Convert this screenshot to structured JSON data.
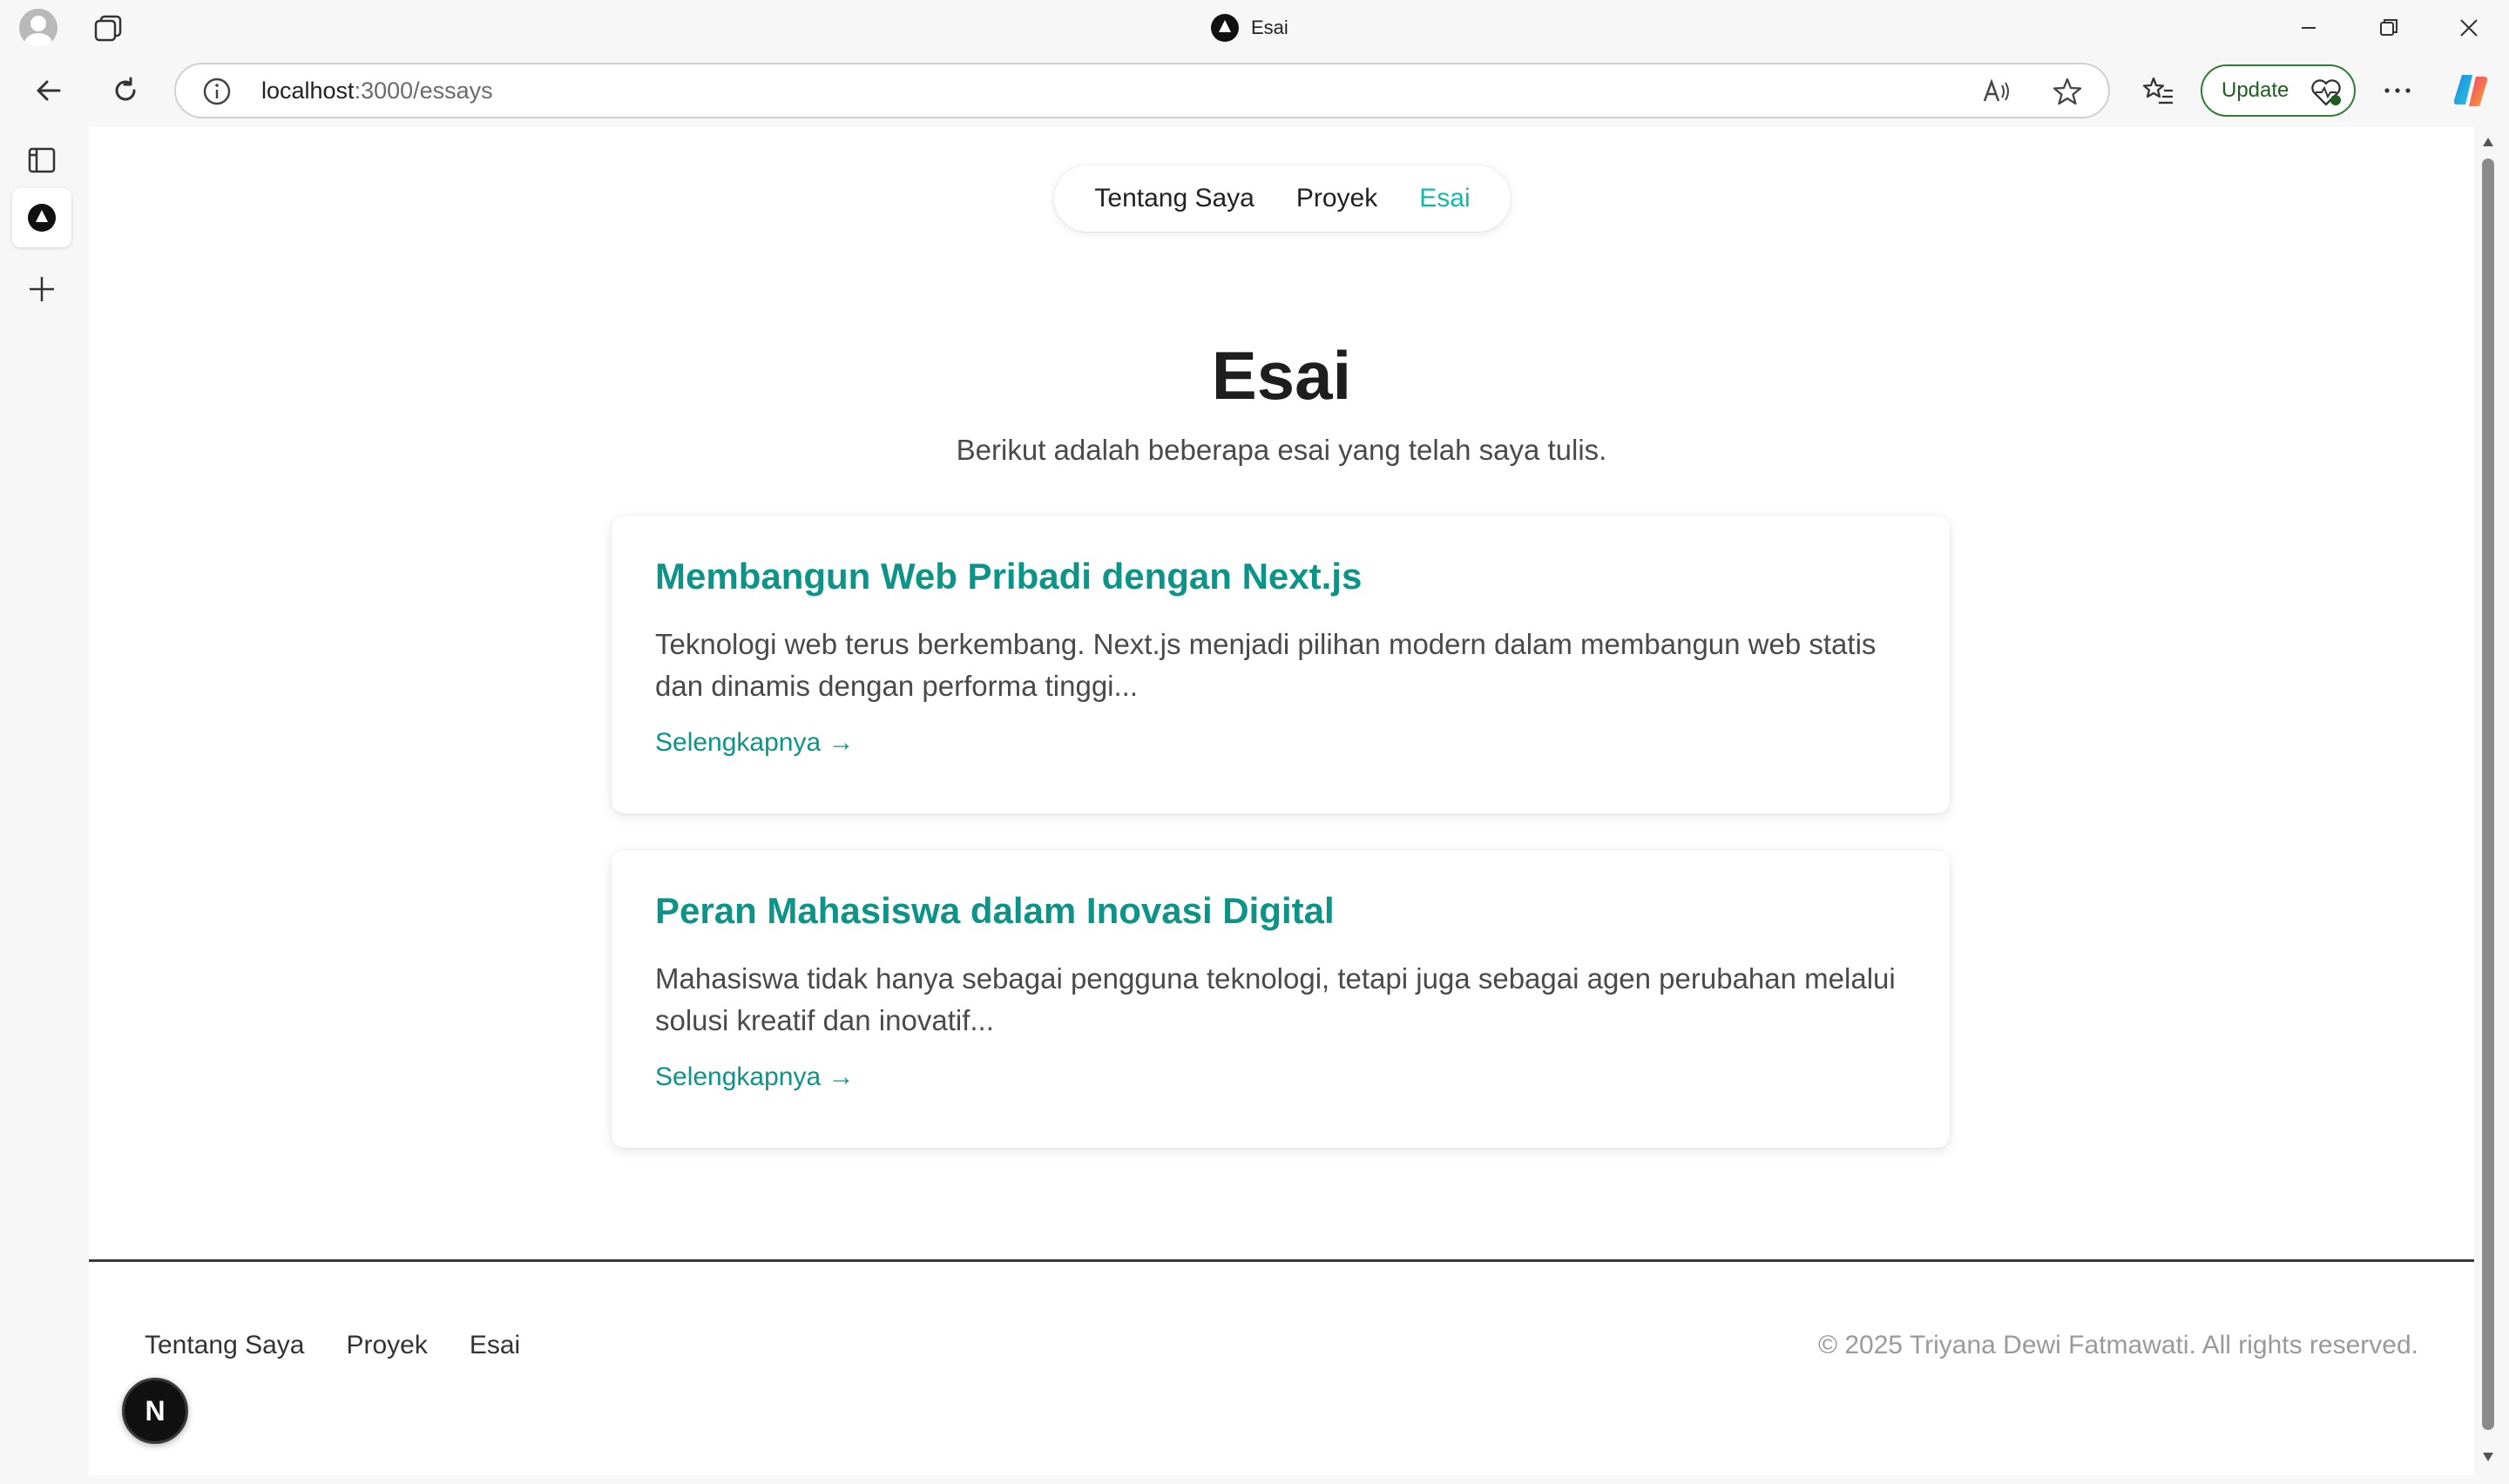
{
  "window": {
    "title": "Esai"
  },
  "toolbar": {
    "url_host": "localhost",
    "url_path": ":3000/essays",
    "update_label": "Update"
  },
  "site_nav": [
    {
      "label": "Tentang Saya",
      "active": false
    },
    {
      "label": "Proyek",
      "active": false
    },
    {
      "label": "Esai",
      "active": true
    }
  ],
  "page": {
    "heading": "Esai",
    "subtitle": "Berikut adalah beberapa esai yang telah saya tulis."
  },
  "essays": [
    {
      "title": "Membangun Web Pribadi dengan Next.js",
      "excerpt": "Teknologi web terus berkembang. Next.js menjadi pilihan modern dalam membangun web statis dan dinamis dengan performa tinggi...",
      "more": "Selengkapnya →"
    },
    {
      "title": "Peran Mahasiswa dalam Inovasi Digital",
      "excerpt": "Mahasiswa tidak hanya sebagai pengguna teknologi, tetapi juga sebagai agen perubahan melalui solusi kreatif dan inovatif...",
      "more": "Selengkapnya →"
    }
  ],
  "footer": {
    "links": [
      "Tentang Saya",
      "Proyek",
      "Esai"
    ],
    "copyright": "© 2025 Triyana Dewi Fatmawati. All rights reserved."
  },
  "next_badge": "N",
  "colors": {
    "accent": "#0d9488",
    "nav_active": "#14b8a6",
    "update_border": "#2e7d32"
  }
}
